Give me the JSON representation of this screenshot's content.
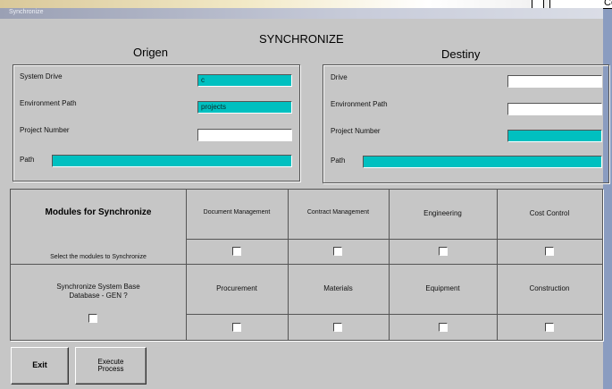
{
  "window": {
    "title": "Synchronize",
    "corner_text": "Co"
  },
  "headings": {
    "main": "SYNCHRONIZE",
    "origin": "Origen",
    "destiny": "Destiny"
  },
  "origin": {
    "system_drive_label": "System Drive",
    "system_drive_value": "c",
    "environment_path_label": "Environment Path",
    "environment_path_value": "projects",
    "project_number_label": "Project Number",
    "project_number_value": "",
    "path_label": "Path",
    "path_value": ""
  },
  "destiny": {
    "drive_label": "Drive",
    "drive_value": "",
    "environment_path_label": "Environment Path",
    "environment_path_value": "",
    "project_number_label": "Project Number",
    "project_number_value": "",
    "path_label": "Path",
    "path_value": ""
  },
  "modules": {
    "title": "Modules for Synchronize",
    "select_label": "Select the modules to Synchronize",
    "gen_label_line1": "Synchronize System Base",
    "gen_label_line2": "Database - GEN ?",
    "gen_checked": false,
    "row1": [
      {
        "label": "Document Management",
        "checked": false
      },
      {
        "label": "Contract Management",
        "checked": false
      },
      {
        "label": "Engineering",
        "checked": false
      },
      {
        "label": "Cost Control",
        "checked": false
      }
    ],
    "row2": [
      {
        "label": "Procurement",
        "checked": false
      },
      {
        "label": "Materials",
        "checked": false
      },
      {
        "label": "Equipment",
        "checked": false
      },
      {
        "label": "Construction",
        "checked": false
      }
    ]
  },
  "buttons": {
    "exit": "Exit",
    "execute_line1": "Execute",
    "execute_line2": "Process"
  },
  "colors": {
    "window_bg": "#c6c6c6",
    "field_cyan": "#00c0c0",
    "field_white": "#ffffff"
  }
}
